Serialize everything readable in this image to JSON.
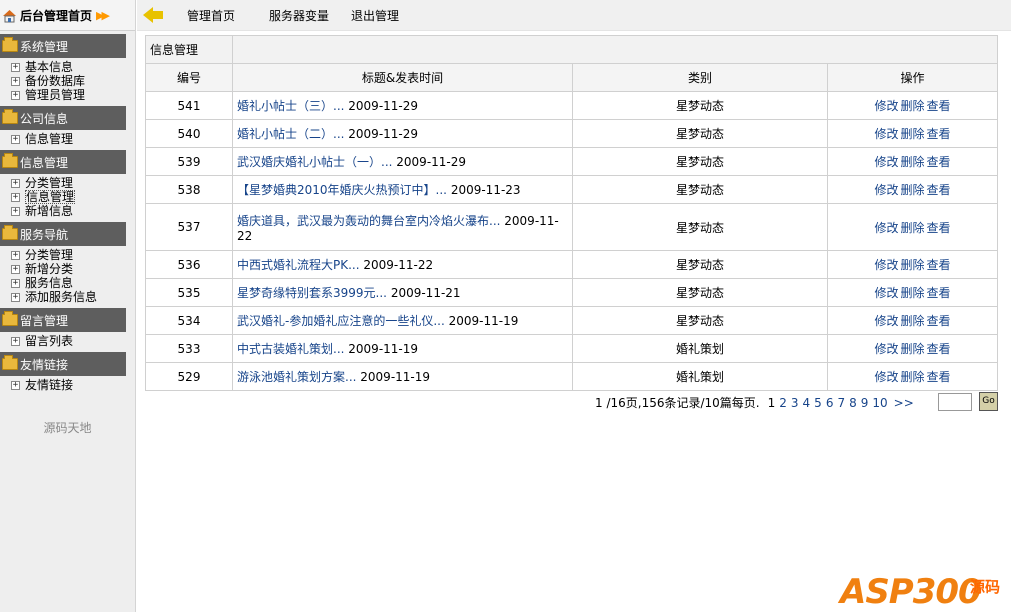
{
  "sidebar": {
    "title": "后台管理首页",
    "groups": [
      {
        "label": "系统管理",
        "items": [
          "基本信息",
          "备份数据库",
          "管理员管理"
        ]
      },
      {
        "label": "公司信息",
        "items": [
          "信息管理"
        ]
      },
      {
        "label": "信息管理",
        "items": [
          "分类管理",
          "信息管理",
          "新增信息"
        ]
      },
      {
        "label": "服务导航",
        "items": [
          "分类管理",
          "新增分类",
          "服务信息",
          "添加服务信息"
        ]
      },
      {
        "label": "留言管理",
        "items": [
          "留言列表"
        ]
      },
      {
        "label": "友情链接",
        "items": [
          "友情链接"
        ]
      }
    ],
    "footer": "源码天地"
  },
  "nav": {
    "home": "管理首页",
    "server_vars": "服务器变量",
    "logout": "退出管理"
  },
  "table": {
    "title": "信息管理",
    "headers": [
      "编号",
      "标题&发表时间",
      "类别",
      "操作"
    ],
    "op_edit": "修改",
    "op_delete": "删除",
    "op_view": "查看",
    "rows": [
      {
        "id": "541",
        "title": "婚礼小帖士（三）...",
        "date": "2009-11-29",
        "category": "星梦动态"
      },
      {
        "id": "540",
        "title": "婚礼小帖士（二）...",
        "date": "2009-11-29",
        "category": "星梦动态"
      },
      {
        "id": "539",
        "title": "武汉婚庆婚礼小帖士（一）...",
        "date": "2009-11-29",
        "category": "星梦动态"
      },
      {
        "id": "538",
        "title": "【星梦婚典2010年婚庆火热预订中】...",
        "date": "2009-11-23",
        "category": "星梦动态"
      },
      {
        "id": "537",
        "title": "婚庆道具，武汉最为轰动的舞台室内冷焰火瀑布...",
        "date": "2009-11-22",
        "category": "星梦动态"
      },
      {
        "id": "536",
        "title": "中西式婚礼流程大PK...",
        "date": "2009-11-22",
        "category": "星梦动态"
      },
      {
        "id": "535",
        "title": "星梦奇缘特别套系3999元...",
        "date": "2009-11-21",
        "category": "星梦动态"
      },
      {
        "id": "534",
        "title": "武汉婚礼-参加婚礼应注意的一些礼仪...",
        "date": "2009-11-19",
        "category": "星梦动态"
      },
      {
        "id": "533",
        "title": "中式古装婚礼策划...",
        "date": "2009-11-19",
        "category": "婚礼策划"
      },
      {
        "id": "529",
        "title": "游泳池婚礼策划方案...",
        "date": "2009-11-19",
        "category": "婚礼策划"
      }
    ]
  },
  "pager": {
    "info": "1 /16页,156条记录/10篇每页.",
    "pages": [
      "1",
      "2",
      "3",
      "4",
      "5",
      "6",
      "7",
      "8",
      "9",
      "10"
    ],
    "next": ">>",
    "go": "Go"
  },
  "watermark": {
    "brand": "ASP300",
    "cn": "源码"
  }
}
